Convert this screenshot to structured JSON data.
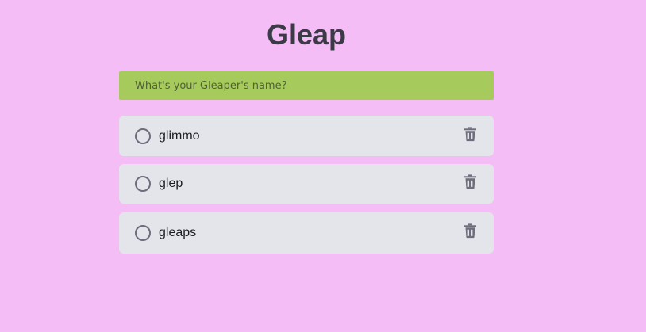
{
  "app": {
    "title": "Gleap"
  },
  "input": {
    "placeholder": "What's your Gleaper's name?",
    "value": ""
  },
  "items": [
    {
      "label": "glimmo",
      "done": false
    },
    {
      "label": "glep",
      "done": false
    },
    {
      "label": "gleaps",
      "done": false
    }
  ],
  "icons": {
    "checkbox": "circle-checkbox-icon",
    "delete": "trash-icon"
  },
  "colors": {
    "background": "#f5bdf5",
    "input_background": "#a6ca5c",
    "item_background": "#e4e5ea",
    "title": "#3b3b47",
    "icon": "#6d6d7d"
  }
}
